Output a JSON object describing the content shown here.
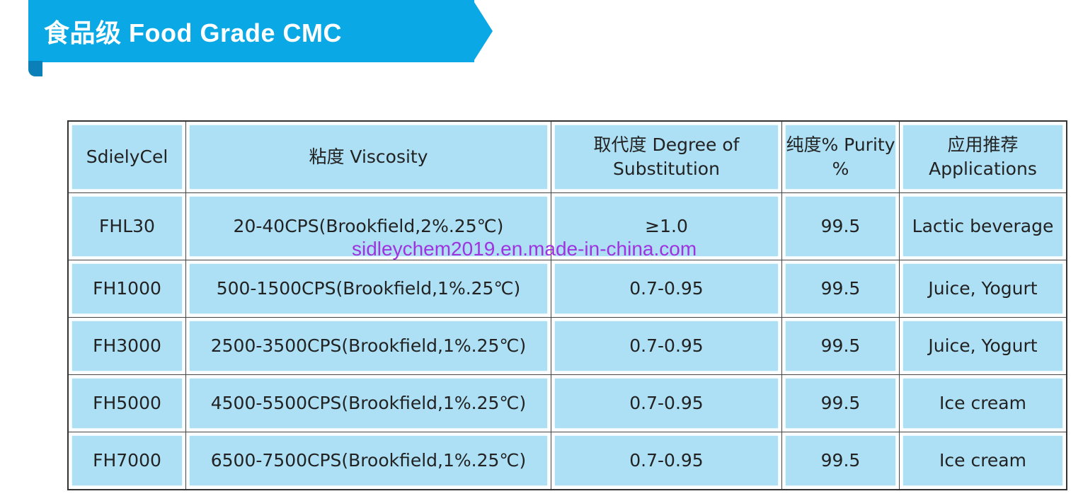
{
  "banner": {
    "title": "食品级 Food Grade CMC",
    "color": "#0aa9e6"
  },
  "table": {
    "headers": [
      "SdielyCel",
      "粘度 Viscosity",
      "取代度 Degree of Substitution",
      "纯度% Purity %",
      "应用推荐 Applications"
    ],
    "rows": [
      [
        "FHL30",
        "20-40CPS(Brookfield,2%.25℃)",
        "≥1.0",
        "99.5",
        "Lactic beverage"
      ],
      [
        "FH1000",
        "500-1500CPS(Brookfield,1%.25℃)",
        "0.7-0.95",
        "99.5",
        "Juice, Yogurt"
      ],
      [
        "FH3000",
        "2500-3500CPS(Brookfield,1%.25℃)",
        "0.7-0.95",
        "99.5",
        "Juice, Yogurt"
      ],
      [
        "FH5000",
        "4500-5500CPS(Brookfield,1%.25℃)",
        "0.7-0.95",
        "99.5",
        "Ice cream"
      ],
      [
        "FH7000",
        "6500-7500CPS(Brookfield,1%.25℃)",
        "0.7-0.95",
        "99.5",
        "Ice cream"
      ]
    ],
    "cell_color": "#ade0f5"
  },
  "watermark": {
    "text": "sidleychem2019.en.made-in-china.com",
    "color": "#a033e0"
  }
}
